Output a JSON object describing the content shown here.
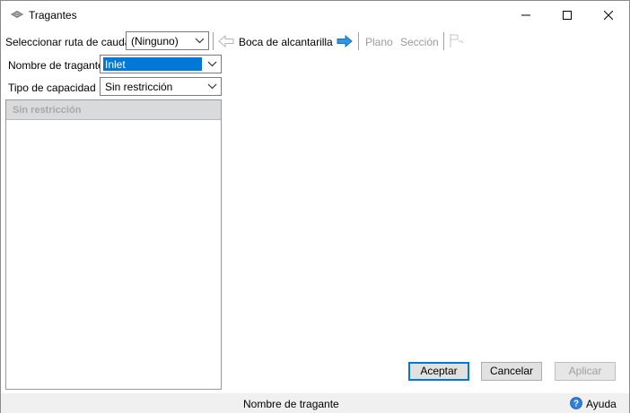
{
  "window": {
    "title": "Tragantes",
    "app_icon": "inlet-icon",
    "controls": [
      "minimize-icon",
      "maximize-icon",
      "close-icon"
    ]
  },
  "toolbar": {
    "route_label": "Seleccionar ruta de caudal",
    "route_value": "(Ninguno)",
    "current_item": "Boca de alcantarilla",
    "plan_label": "Plano",
    "section_label": "Sección",
    "prev_icon": "arrow-left-icon",
    "next_icon": "arrow-right-icon",
    "extra_icon": "flag-icon"
  },
  "form": {
    "inlet_name_label": "Nombre de tragante",
    "inlet_name_value": "Inlet",
    "capacity_type_label": "Tipo de capacidad",
    "capacity_type_value": "Sin restricción"
  },
  "panel": {
    "header": "Sin restricción"
  },
  "buttons": {
    "accept": "Aceptar",
    "cancel": "Cancelar",
    "apply": "Aplicar"
  },
  "statusbar": {
    "text": "Nombre de tragante",
    "help_label": "Ayuda",
    "help_icon": "help-icon"
  },
  "colors": {
    "selection": "#0078d7",
    "accent_arrow": "#1e8be6",
    "disabled_text": "#9a9a9a",
    "statusbar_bg": "#f0f0f0"
  }
}
